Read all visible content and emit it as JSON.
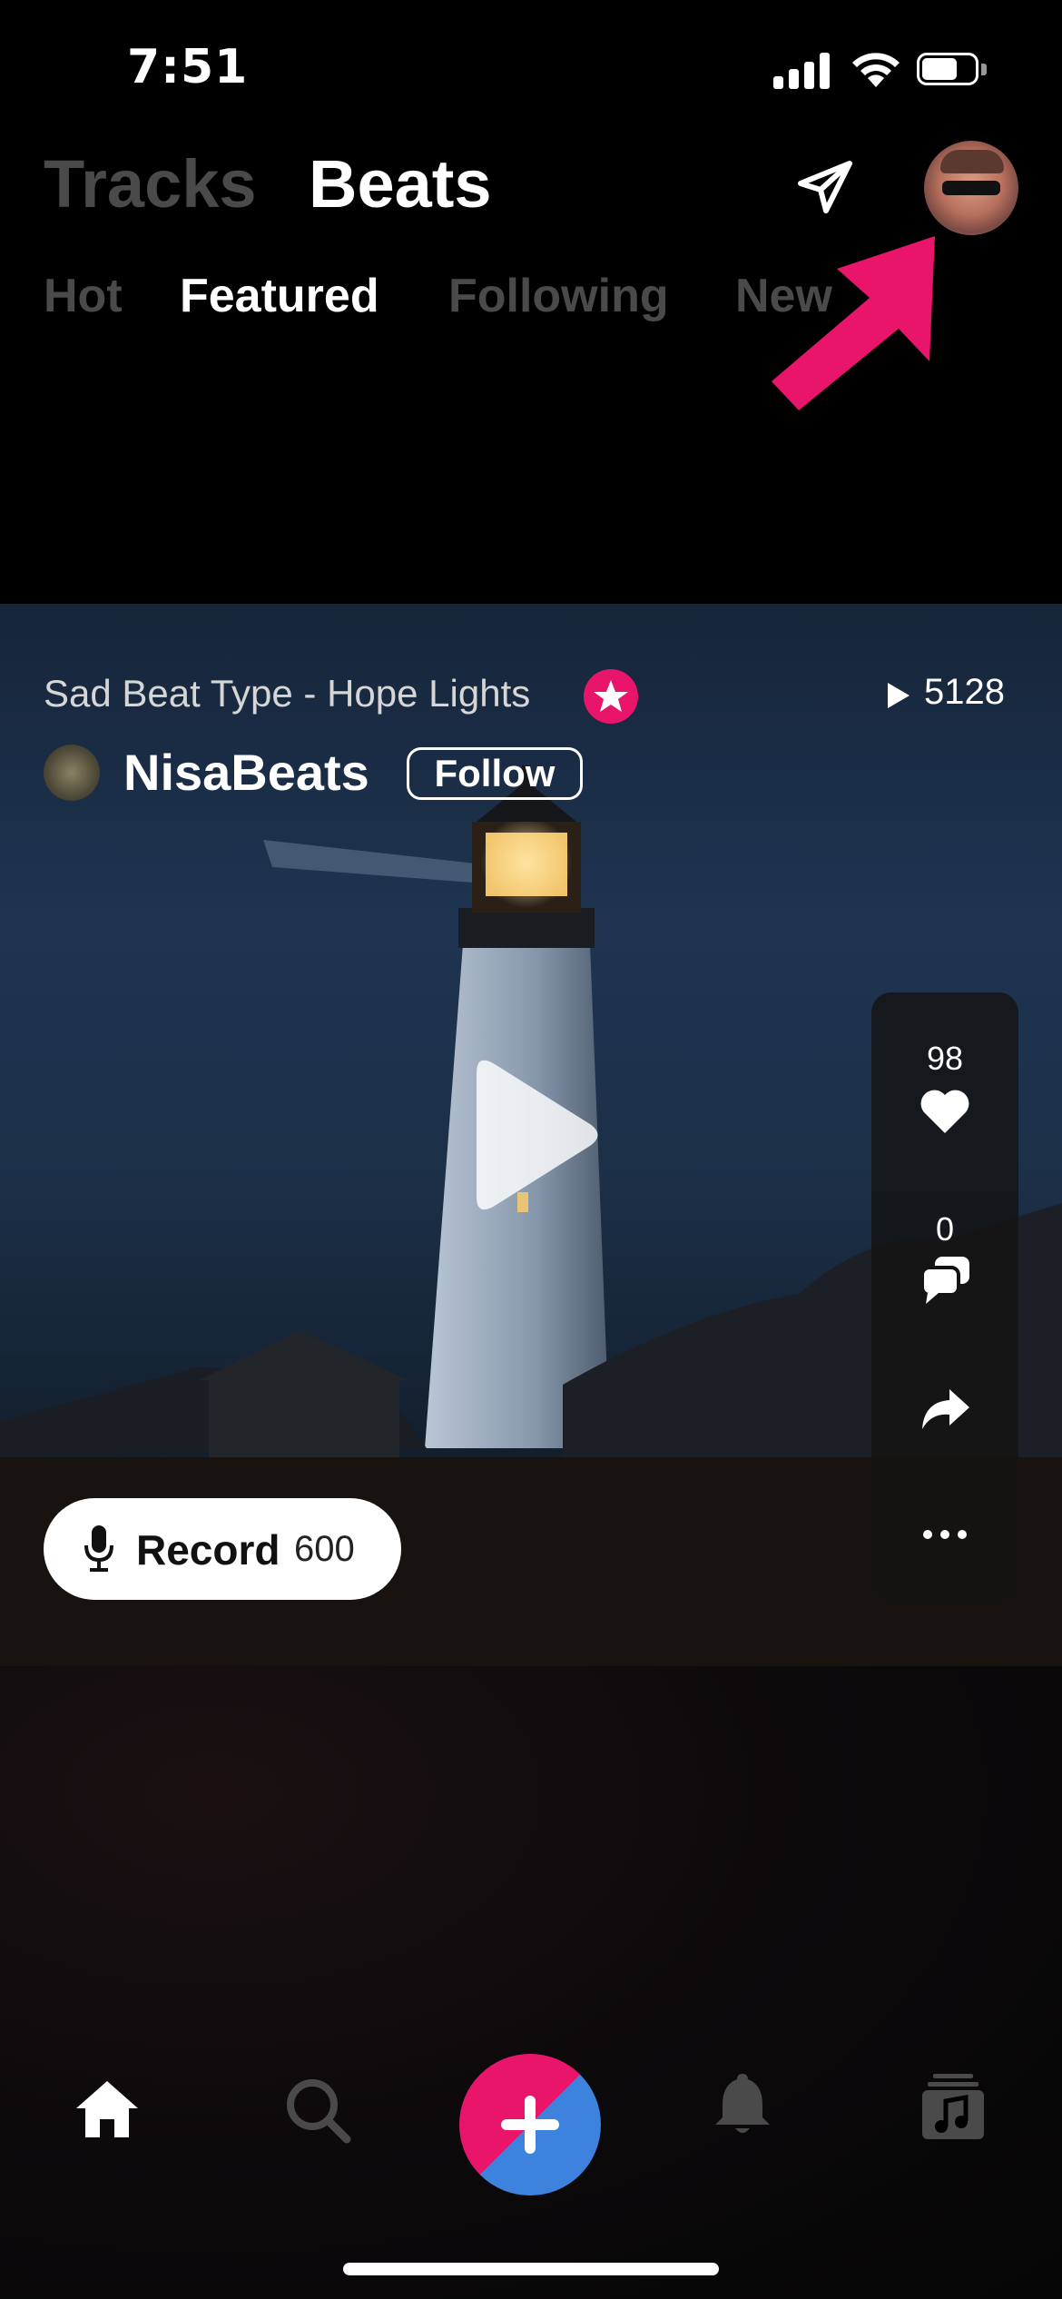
{
  "status_bar": {
    "time": "7:51"
  },
  "header": {
    "top_tabs": [
      {
        "label": "Tracks",
        "active": false
      },
      {
        "label": "Beats",
        "active": true
      }
    ],
    "sub_tabs": [
      {
        "label": "Hot",
        "active": false
      },
      {
        "label": "Featured",
        "active": true
      },
      {
        "label": "Following",
        "active": false
      },
      {
        "label": "New",
        "active": false
      }
    ],
    "icons": [
      "send-icon",
      "profile-avatar"
    ]
  },
  "post": {
    "title": "Sad Beat Type - Hope Lights",
    "plays": "5128",
    "artist": "NisaBeats",
    "follow_label": "Follow",
    "likes": "98",
    "comments": "0",
    "record_label": "Record",
    "record_count": "600"
  },
  "bottom_nav": [
    "home-icon",
    "search-icon",
    "create-button",
    "notifications-icon",
    "library-icon"
  ],
  "colors": {
    "accent": "#e8156b",
    "secondary": "#3d83dd",
    "inactive": "#4a4a4a",
    "background": "#000000"
  }
}
